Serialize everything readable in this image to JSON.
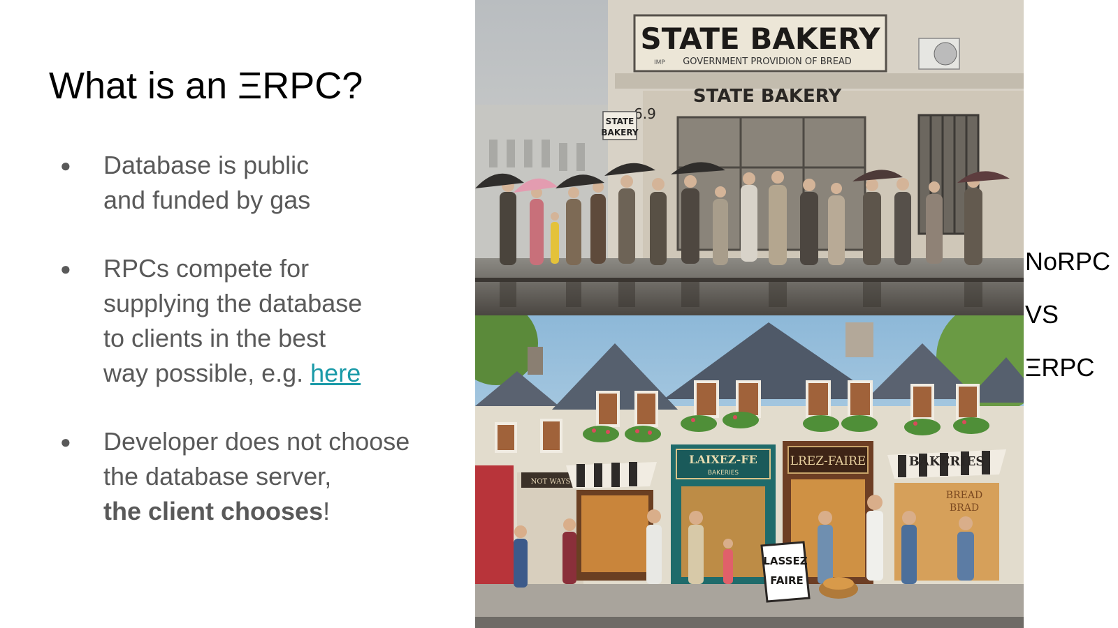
{
  "slide": {
    "title": "What is an ΞRPC?",
    "bullets": [
      {
        "lines": [
          "Database is public",
          "and funded by gas"
        ]
      },
      {
        "lines": [
          "RPCs compete for",
          "supplying the database",
          "to clients in the best"
        ],
        "last_prefix": "way possible, e.g. ",
        "link_text": "here"
      },
      {
        "lines": [
          "Developer does not choose",
          "the database server,"
        ],
        "bold_text": "the client chooses",
        "suffix": "!"
      }
    ],
    "bullet_glyph": "●"
  },
  "image_top": {
    "sign_main": "STATE BAKERY",
    "sign_sub": "GOVERNMENT PROVIDION OF BREAD",
    "sign_sub_prefix": "IMP",
    "facade_sign": "STATE BAKERY",
    "small_sign_1": "STATE",
    "small_sign_2": "BAKERY",
    "number": "6.9"
  },
  "image_bottom": {
    "shop_sign_1_line1": "LAIXEZ-FE",
    "shop_sign_1_line2": "BAKERIES",
    "shop_sign_2": "LREZ-FAIRE",
    "shop_sign_3": "BAKERIES",
    "window_text_1": "BREAD",
    "window_text_2": "BRAD",
    "sandwich_board_1": "LASSEZ",
    "sandwich_board_2": "FAIRE",
    "small_shop_sign": "NOT WAYS"
  },
  "side_labels": [
    "NoRPC",
    "VS",
    "ΞRPC"
  ],
  "colors": {
    "text": "#595959",
    "link": "#1a9aa8",
    "title": "#000000"
  }
}
